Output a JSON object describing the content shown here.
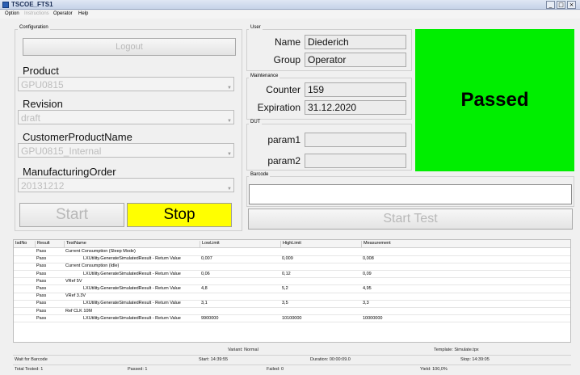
{
  "window": {
    "title": "TSCOE_FTS1",
    "min": "_",
    "max": "□",
    "close": "×"
  },
  "menu": [
    "Option",
    "Instructions",
    "Operator",
    "Help"
  ],
  "config": {
    "label": "Configuration",
    "logout": "Logout",
    "product_label": "Product",
    "product_value": "GPU0815",
    "revision_label": "Revision",
    "revision_value": "draft",
    "cpn_label": "CustomerProductName",
    "cpn_value": "GPU0815_Internal",
    "mo_label": "ManufacturingOrder",
    "mo_value": "20131212",
    "start": "Start",
    "stop": "Stop"
  },
  "user": {
    "label": "User",
    "name_label": "Name",
    "name": "Diederich",
    "group_label": "Group",
    "group": "Operator"
  },
  "maintenance": {
    "label": "Maintenance",
    "counter_label": "Counter",
    "counter": "159",
    "expiration_label": "Expiration",
    "expiration": "31.12.2020"
  },
  "dut": {
    "label": "DUT",
    "param1_label": "param1",
    "param1": "",
    "param2_label": "param2",
    "param2": ""
  },
  "barcode": {
    "label": "Barcode",
    "value": ""
  },
  "result": {
    "text": "Passed",
    "color": "#00ee00"
  },
  "start_test": "Start Test",
  "table": {
    "headers": [
      "IsdNo",
      "Result",
      "TestName",
      "LowLimit",
      "HighLimit",
      "Measurement"
    ],
    "rows": [
      {
        "result": "Pass",
        "name": "Current Consumption (Sleep Mode)",
        "low": "",
        "high": "",
        "meas": "",
        "indent": false
      },
      {
        "result": "Pass",
        "name": "LXUtility.GenerateSimulatedResult - Return Value",
        "low": "0,007",
        "high": "0,009",
        "meas": "0,008",
        "indent": true
      },
      {
        "result": "Pass",
        "name": "Current Consumption (Idle)",
        "low": "",
        "high": "",
        "meas": "",
        "indent": false
      },
      {
        "result": "Pass",
        "name": "LXUtility.GenerateSimulatedResult - Return Value",
        "low": "0,06",
        "high": "0,12",
        "meas": "0,09",
        "indent": true
      },
      {
        "result": "Pass",
        "name": "VRef 5V",
        "low": "",
        "high": "",
        "meas": "",
        "indent": false
      },
      {
        "result": "Pass",
        "name": "LXUtility.GenerateSimulatedResult - Return Value",
        "low": "4,8",
        "high": "5,2",
        "meas": "4,95",
        "indent": true
      },
      {
        "result": "Pass",
        "name": "VRef 3.3V",
        "low": "",
        "high": "",
        "meas": "",
        "indent": false
      },
      {
        "result": "Pass",
        "name": "LXUtility.GenerateSimulatedResult - Return Value",
        "low": "3,1",
        "high": "3,5",
        "meas": "3,3",
        "indent": true
      },
      {
        "result": "Pass",
        "name": "Ref CLK 10M",
        "low": "",
        "high": "",
        "meas": "",
        "indent": false
      },
      {
        "result": "Pass",
        "name": "LXUtility.GenerateSimulatedResult - Return Value",
        "low": "9900000",
        "high": "10100000",
        "meas": "10000000",
        "indent": true
      }
    ]
  },
  "status": {
    "variant": "Variant: Normal",
    "template": "Template: Simulate.tpx",
    "wait": "Wait for Barcode",
    "start": "Start: 14:39:55",
    "duration": "Duration: 00:00:09.0",
    "stop": "Stop: 14:39:05",
    "total": "Total Tested: 1",
    "passed": "Passed: 1",
    "failed": "Failed: 0",
    "yield": "Yield: 100,0%"
  }
}
